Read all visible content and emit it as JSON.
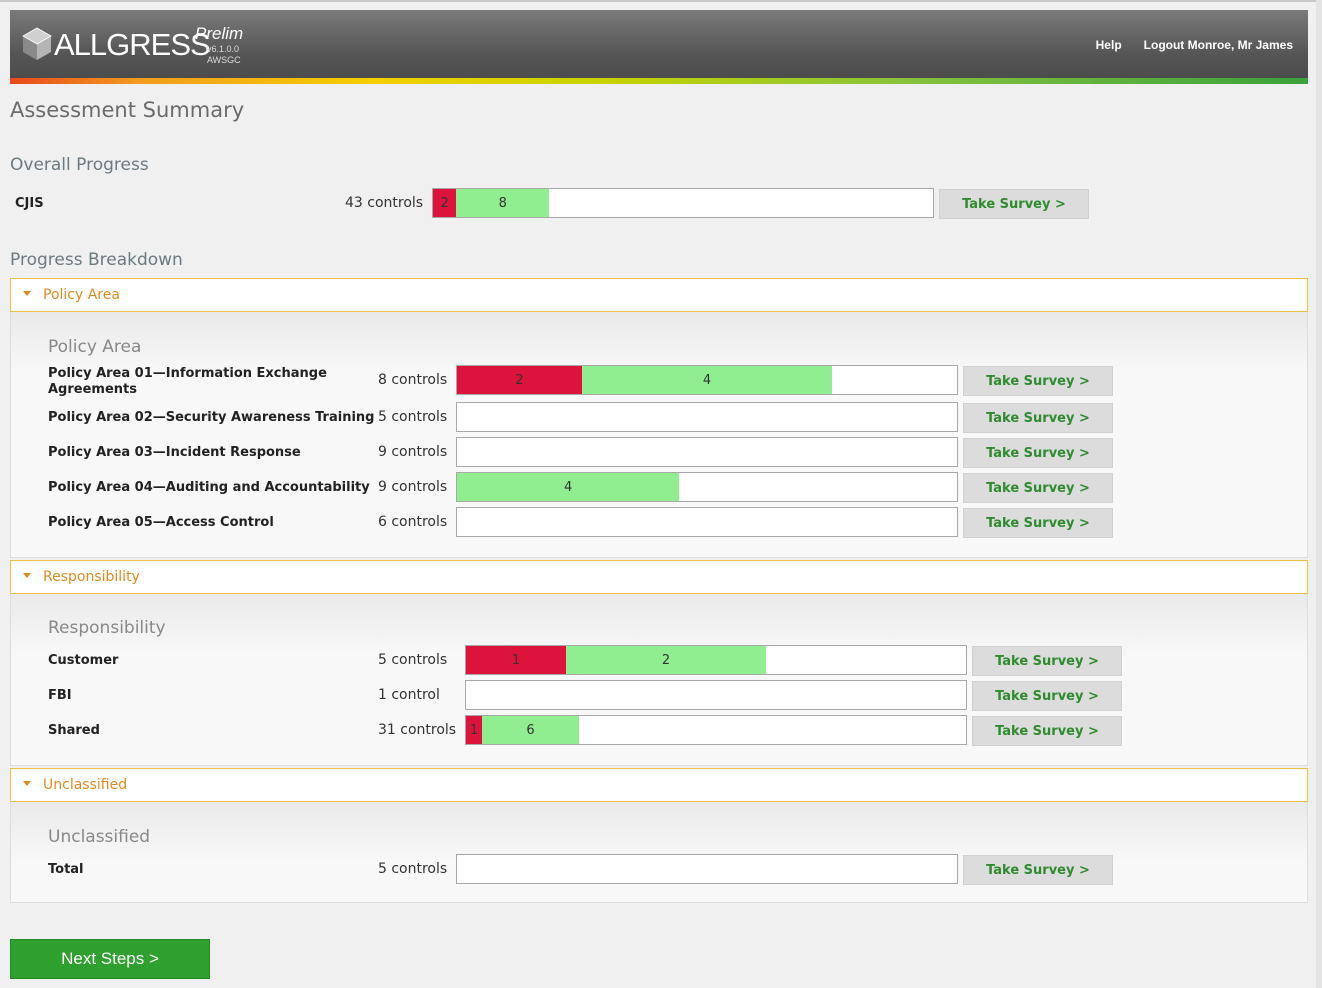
{
  "header": {
    "brand": "ALLGRESS",
    "edition": "Prelim",
    "version": "v6.1.0.0",
    "instance": "AWSGC",
    "links": {
      "help": "Help",
      "logout": "Logout Monroe, Mr James"
    }
  },
  "page_title": "Assessment Summary",
  "overall": {
    "title": "Overall Progress",
    "row": {
      "label": "CJIS",
      "count": "43 controls",
      "red": 2,
      "green": 8,
      "total": 43,
      "button": "Take Survey >"
    }
  },
  "breakdown_title": "Progress Breakdown",
  "sections": {
    "policy": {
      "header": "Policy Area",
      "subtitle": "Policy Area",
      "rows": [
        {
          "label": "Policy Area 01—Information Exchange Agreements",
          "count": "8 controls",
          "red": 2,
          "green": 4,
          "total": 8,
          "button": "Take Survey >"
        },
        {
          "label": "Policy Area 02—Security Awareness Training",
          "count": "5 controls",
          "red": 0,
          "green": 0,
          "total": 5,
          "button": "Take Survey >"
        },
        {
          "label": "Policy Area 03—Incident Response",
          "count": "9 controls",
          "red": 0,
          "green": 0,
          "total": 9,
          "button": "Take Survey >"
        },
        {
          "label": "Policy Area 04—Auditing and Accountability",
          "count": "9 controls",
          "red": 0,
          "green": 4,
          "total": 9,
          "button": "Take Survey >"
        },
        {
          "label": "Policy Area 05—Access Control",
          "count": "6 controls",
          "red": 0,
          "green": 0,
          "total": 6,
          "button": "Take Survey >"
        }
      ]
    },
    "responsibility": {
      "header": "Responsibility",
      "subtitle": "Responsibility",
      "rows": [
        {
          "label": "Customer",
          "count": "5 controls",
          "red": 1,
          "green": 2,
          "total": 5,
          "button": "Take Survey >"
        },
        {
          "label": "FBI",
          "count": "1 control",
          "red": 0,
          "green": 0,
          "total": 1,
          "button": "Take Survey >"
        },
        {
          "label": "Shared",
          "count": "31 controls",
          "red": 1,
          "green": 6,
          "total": 31,
          "button": "Take Survey >"
        }
      ]
    },
    "unclassified": {
      "header": "Unclassified",
      "subtitle": "Unclassified",
      "rows": [
        {
          "label": "Total",
          "count": "5 controls",
          "red": 0,
          "green": 0,
          "total": 5,
          "button": "Take Survey >"
        }
      ]
    }
  },
  "next_button": "Next Steps >",
  "colors": {
    "red": "#dc143c",
    "green": "#90ee90",
    "accent": "#e08a1e",
    "button_green": "#2ea02e"
  }
}
